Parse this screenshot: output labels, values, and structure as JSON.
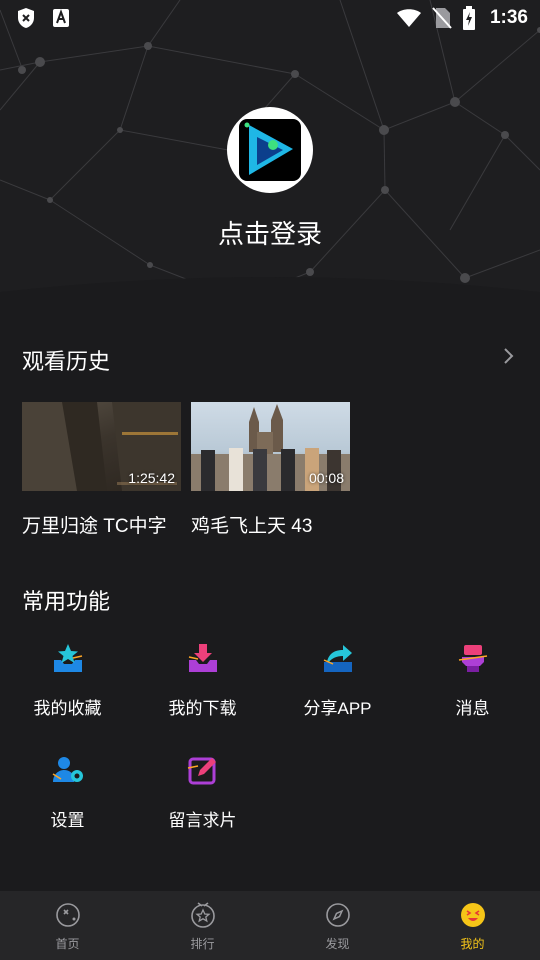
{
  "status_bar": {
    "time": "1:36",
    "icons": [
      "shield-x-icon",
      "font-a-icon",
      "wifi-icon",
      "no-sim-icon",
      "battery-charging-icon"
    ]
  },
  "profile": {
    "login_label": "点击登录",
    "avatar_icon": "app-play-logo-icon"
  },
  "history": {
    "title": "观看历史",
    "items": [
      {
        "label": "万里归途 TC中字",
        "duration": "1:25:42"
      },
      {
        "label": "鸡毛飞上天 43",
        "duration": "00:08"
      }
    ]
  },
  "functions": {
    "title": "常用功能",
    "items": [
      {
        "label": "我的收藏",
        "icon": "star-tray-icon"
      },
      {
        "label": "我的下载",
        "icon": "download-tray-icon"
      },
      {
        "label": "分享APP",
        "icon": "share-arrow-icon"
      },
      {
        "label": "消息",
        "icon": "message-icon"
      },
      {
        "label": "设置",
        "icon": "user-gear-icon"
      },
      {
        "label": "留言求片",
        "icon": "edit-pencil-icon"
      }
    ]
  },
  "bottom_nav": {
    "items": [
      {
        "label": "首页",
        "icon": "home-icon",
        "active": false
      },
      {
        "label": "排行",
        "icon": "rank-icon",
        "active": false
      },
      {
        "label": "发现",
        "icon": "compass-icon",
        "active": false
      },
      {
        "label": "我的",
        "icon": "smiley-icon",
        "active": true
      }
    ]
  },
  "colors": {
    "background": "#1b1b1d",
    "header": "#1e1e20",
    "nav_bg": "#262628",
    "accent_active": "#f5c518",
    "icon_blue": "#1e88e5",
    "icon_pink": "#d63fb0"
  }
}
